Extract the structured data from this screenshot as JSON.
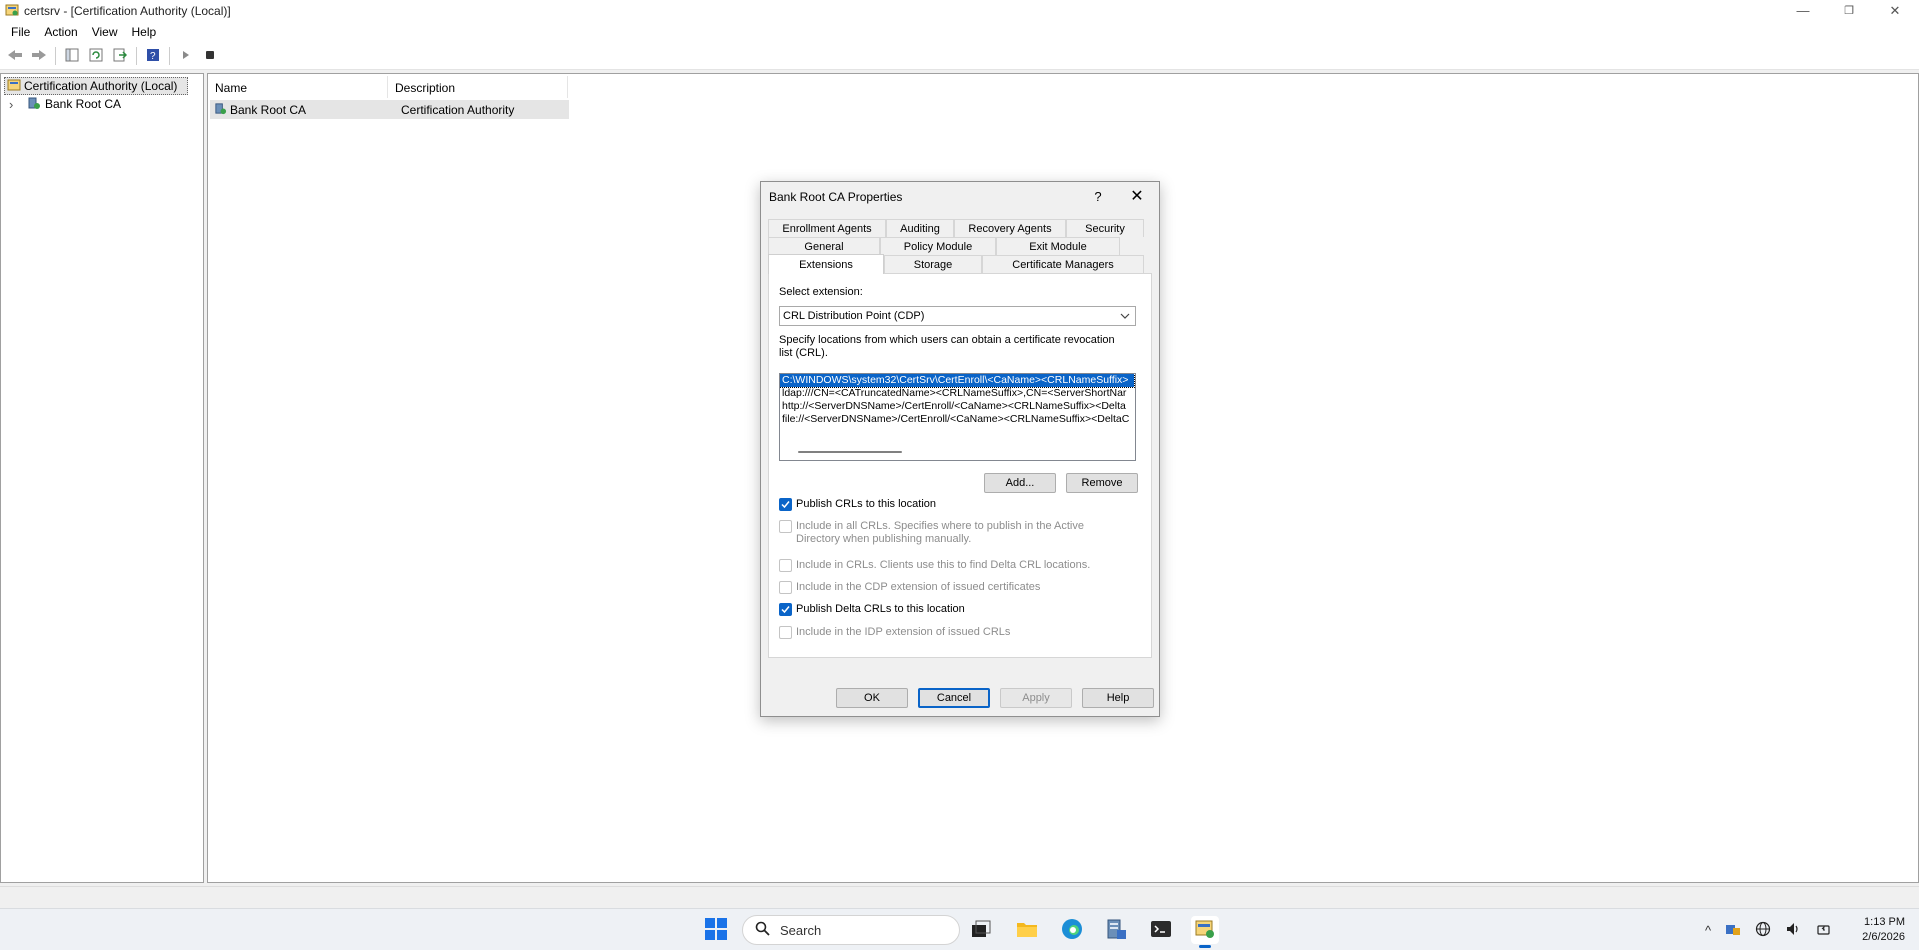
{
  "window": {
    "title": "certsrv - [Certification Authority (Local)]",
    "minimize": "—",
    "restore": "❐",
    "close": "✕"
  },
  "menu": [
    "File",
    "Action",
    "View",
    "Help"
  ],
  "tree": {
    "root": "Certification Authority (Local)",
    "child": "Bank Root CA",
    "expander": "›"
  },
  "list": {
    "columns": [
      "Name",
      "Description"
    ],
    "rows": [
      {
        "name": "Bank Root CA",
        "description": "Certification Authority"
      }
    ]
  },
  "dialog": {
    "title": "Bank Root CA Properties",
    "help_glyph": "?",
    "close_glyph": "✕",
    "tabs_row1": [
      "Enrollment Agents",
      "Auditing",
      "Recovery Agents",
      "Security"
    ],
    "tabs_row2": [
      "General",
      "Policy Module",
      "Exit Module"
    ],
    "tabs_row3": [
      "Extensions",
      "Storage",
      "Certificate Managers"
    ],
    "active_tab": "Extensions",
    "select_label": "Select extension:",
    "select_value": "CRL Distribution Point (CDP)",
    "description": "Specify locations from which users can obtain a certificate revocation list (CRL).",
    "locations": [
      "C:\\WINDOWS\\system32\\CertSrv\\CertEnroll\\<CaName><CRLNameSuffix>",
      "ldap:///CN=<CATruncatedName><CRLNameSuffix>,CN=<ServerShortNar",
      "http://<ServerDNSName>/CertEnroll/<CaName><CRLNameSuffix><Delta",
      "file://<ServerDNSName>/CertEnroll/<CaName><CRLNameSuffix><DeltaC"
    ],
    "add_label": "Add...",
    "remove_label": "Remove",
    "checkboxes": [
      {
        "label": "Publish CRLs to this location",
        "checked": true,
        "enabled": true
      },
      {
        "label": "Include in all CRLs. Specifies where to publish in the Active Directory when publishing manually.",
        "checked": false,
        "enabled": false
      },
      {
        "label": "Include in CRLs. Clients use this to find Delta CRL locations.",
        "checked": false,
        "enabled": false
      },
      {
        "label": "Include in the CDP extension of issued certificates",
        "checked": false,
        "enabled": false
      },
      {
        "label": "Publish Delta CRLs to this location",
        "checked": true,
        "enabled": true
      },
      {
        "label": "Include in the IDP extension of issued CRLs",
        "checked": false,
        "enabled": false
      }
    ],
    "buttons": {
      "ok": "OK",
      "cancel": "Cancel",
      "apply": "Apply",
      "help": "Help"
    }
  },
  "taskbar": {
    "search_placeholder": "Search",
    "time": "1:13 PM",
    "date": "2/6/2026",
    "tray_chevron": "^"
  },
  "colors": {
    "accent": "#0a64c8",
    "selection_bg": "#e5e5e5"
  }
}
